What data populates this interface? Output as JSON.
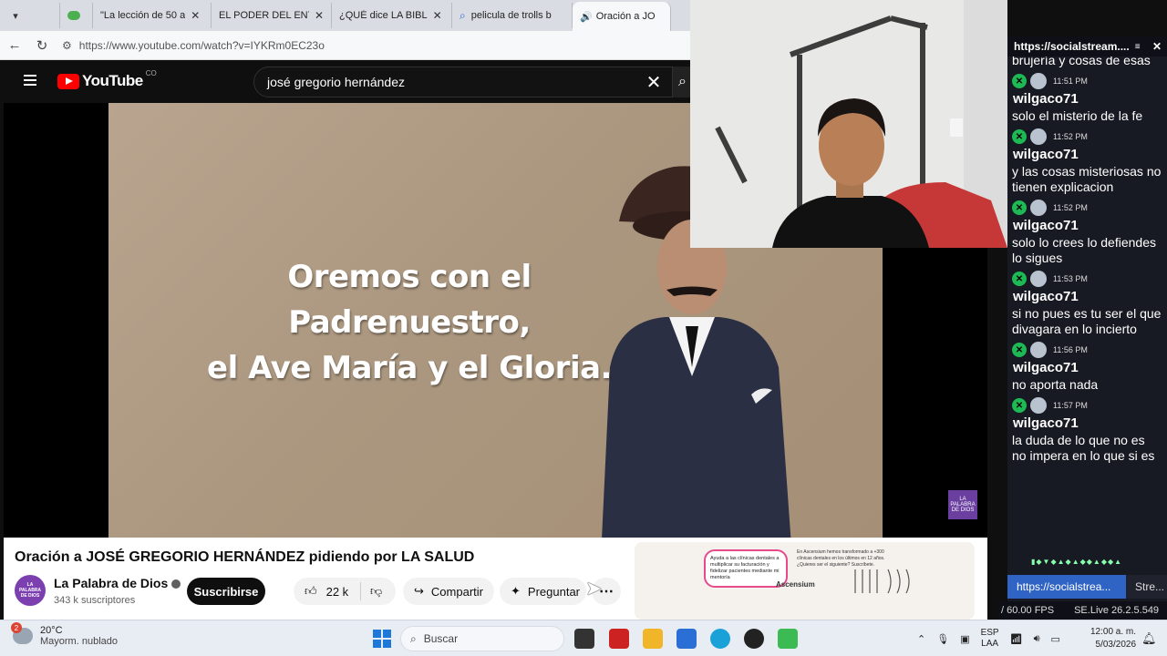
{
  "browser": {
    "tabs": [
      {
        "label": "",
        "favicon": "camera-icon"
      },
      {
        "label": "",
        "favicon": "green-icon"
      },
      {
        "label": "\"La lección de 50 a",
        "favicon": "youtube-icon"
      },
      {
        "label": "EL PODER DEL ENT",
        "favicon": "youtube-icon"
      },
      {
        "label": "¿QUÉ dice LA BIBL",
        "favicon": "youtube-icon"
      },
      {
        "label": "pelicula de trolls b",
        "favicon": "search-icon"
      },
      {
        "label": "Oración a JO",
        "favicon": "youtube-icon"
      }
    ],
    "url": "https://www.youtube.com/watch?v=IYKRm0EC23o"
  },
  "youtube": {
    "logo_text": "YouTube",
    "country": "CO",
    "search_query": "josé gregorio hernández",
    "caption_line1": "Oremos con el Padrenuestro,",
    "caption_line2": "el Ave María y el Gloria.",
    "watermark": "LA PALABRA DE DIOS",
    "video_title": "Oración a JOSÉ GREGORIO HERNÁNDEZ pidiendo por LA SALUD",
    "channel_name": "La Palabra de Dios",
    "channel_avatar": "LA PALABRA DE DIOS",
    "subscribers": "343 k suscriptores",
    "subscribe_label": "Suscribirse",
    "likes": "22 k",
    "share_label": "Compartir",
    "ask_label": "Preguntar",
    "ad": {
      "bubble": "Ayuda a las clínicas dentales a multiplicar su facturación y fidelizar pacientes mediante mi mentoría",
      "text": "En Ascensium hemos transformado a +300 clínicas dentales en los últimos en 12 años. ¿Quieres ser el siguiente? Suscríbete.",
      "brand": "Ascensium"
    }
  },
  "chat": {
    "title": "https://socialstream....",
    "first_text": "brujería y cosas de esas",
    "messages": [
      {
        "time": "11:51 PM",
        "user": "wilgaco71",
        "text": "solo el misterio de la fe"
      },
      {
        "time": "11:52 PM",
        "user": "wilgaco71",
        "text": "y las cosas misteriosas no tienen explicacion"
      },
      {
        "time": "11:52 PM",
        "user": "wilgaco71",
        "text": "solo lo crees lo defiendes lo sigues"
      },
      {
        "time": "11:53 PM",
        "user": "wilgaco71",
        "text": "si no pues es tu ser el que divagara en lo incierto"
      },
      {
        "time": "11:56 PM",
        "user": "wilgaco71",
        "text": "no aporta nada"
      },
      {
        "time": "11:57 PM",
        "user": "wilgaco71",
        "text": "la duda de lo que no es no impera en lo que si es"
      }
    ],
    "footer_url": "https://socialstrea...",
    "footer_second": "Stre...",
    "fps": "/ 60.00 FPS",
    "version": "SE.Live 26.2.5.549"
  },
  "taskbar": {
    "weather_badge": "2",
    "temp": "20°C",
    "condition": "Mayorm. nublado",
    "search_label": "Buscar",
    "lang_1": "ESP",
    "lang_2": "LAA",
    "time": "12:00 a. m.",
    "date": "5/03/2026"
  }
}
